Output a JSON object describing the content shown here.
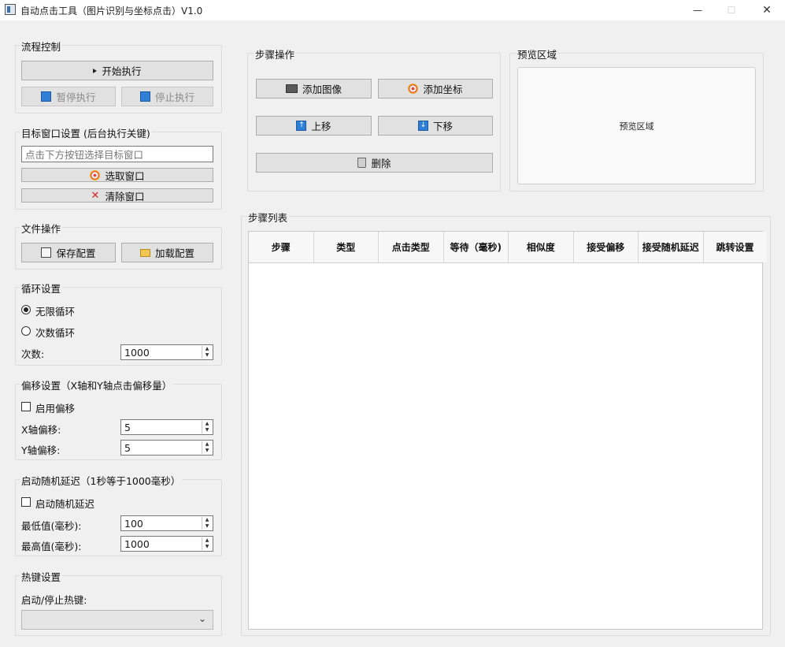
{
  "window": {
    "title": "自动点击工具（图片识别与坐标点击）V1.0",
    "controls": {
      "minimize": "—",
      "maximize": "☐",
      "close": "✕"
    }
  },
  "process_control": {
    "title": "流程控制",
    "start_label": "开始执行",
    "pause_label": "暂停执行",
    "stop_label": "停止执行"
  },
  "target_window": {
    "title": "目标窗口设置 (后台执行关键)",
    "input_placeholder": "点击下方按钮选择目标窗口",
    "select_label": "选取窗口",
    "clear_label": "清除窗口"
  },
  "file_ops": {
    "title": "文件操作",
    "save_label": "保存配置",
    "load_label": "加载配置"
  },
  "loop": {
    "title": "循环设置",
    "infinite_label": "无限循环",
    "count_label": "次数循环",
    "times_label": "次数:",
    "times_value": "1000",
    "selected": "infinite"
  },
  "offset": {
    "title": "偏移设置（X轴和Y轴点击偏移量）",
    "enable_label": "启用偏移",
    "enabled": false,
    "x_label": "X轴偏移:",
    "x_value": "5",
    "y_label": "Y轴偏移:",
    "y_value": "5"
  },
  "random_delay": {
    "title": "启动随机延迟（1秒等于1000毫秒）",
    "enable_label": "启动随机延迟",
    "enabled": false,
    "min_label": "最低值(毫秒):",
    "min_value": "100",
    "max_label": "最高值(毫秒):",
    "max_value": "1000"
  },
  "hotkey": {
    "title": "热键设置",
    "label": "启动/停止热键:",
    "value": ""
  },
  "step_ops": {
    "title": "步骤操作",
    "add_image_label": "添加图像",
    "add_coord_label": "添加坐标",
    "move_up_label": "上移",
    "move_down_label": "下移",
    "delete_label": "删除"
  },
  "preview": {
    "title": "预览区域",
    "placeholder": "预览区域"
  },
  "step_list": {
    "title": "步骤列表",
    "columns": [
      "步骤",
      "类型",
      "点击类型",
      "等待（毫秒)",
      "相似度",
      "接受偏移",
      "接受随机延迟",
      "跳转设置"
    ],
    "rows": []
  },
  "colors": {
    "accent_blue": "#2f7fd6",
    "background": "#f0f0f0"
  }
}
